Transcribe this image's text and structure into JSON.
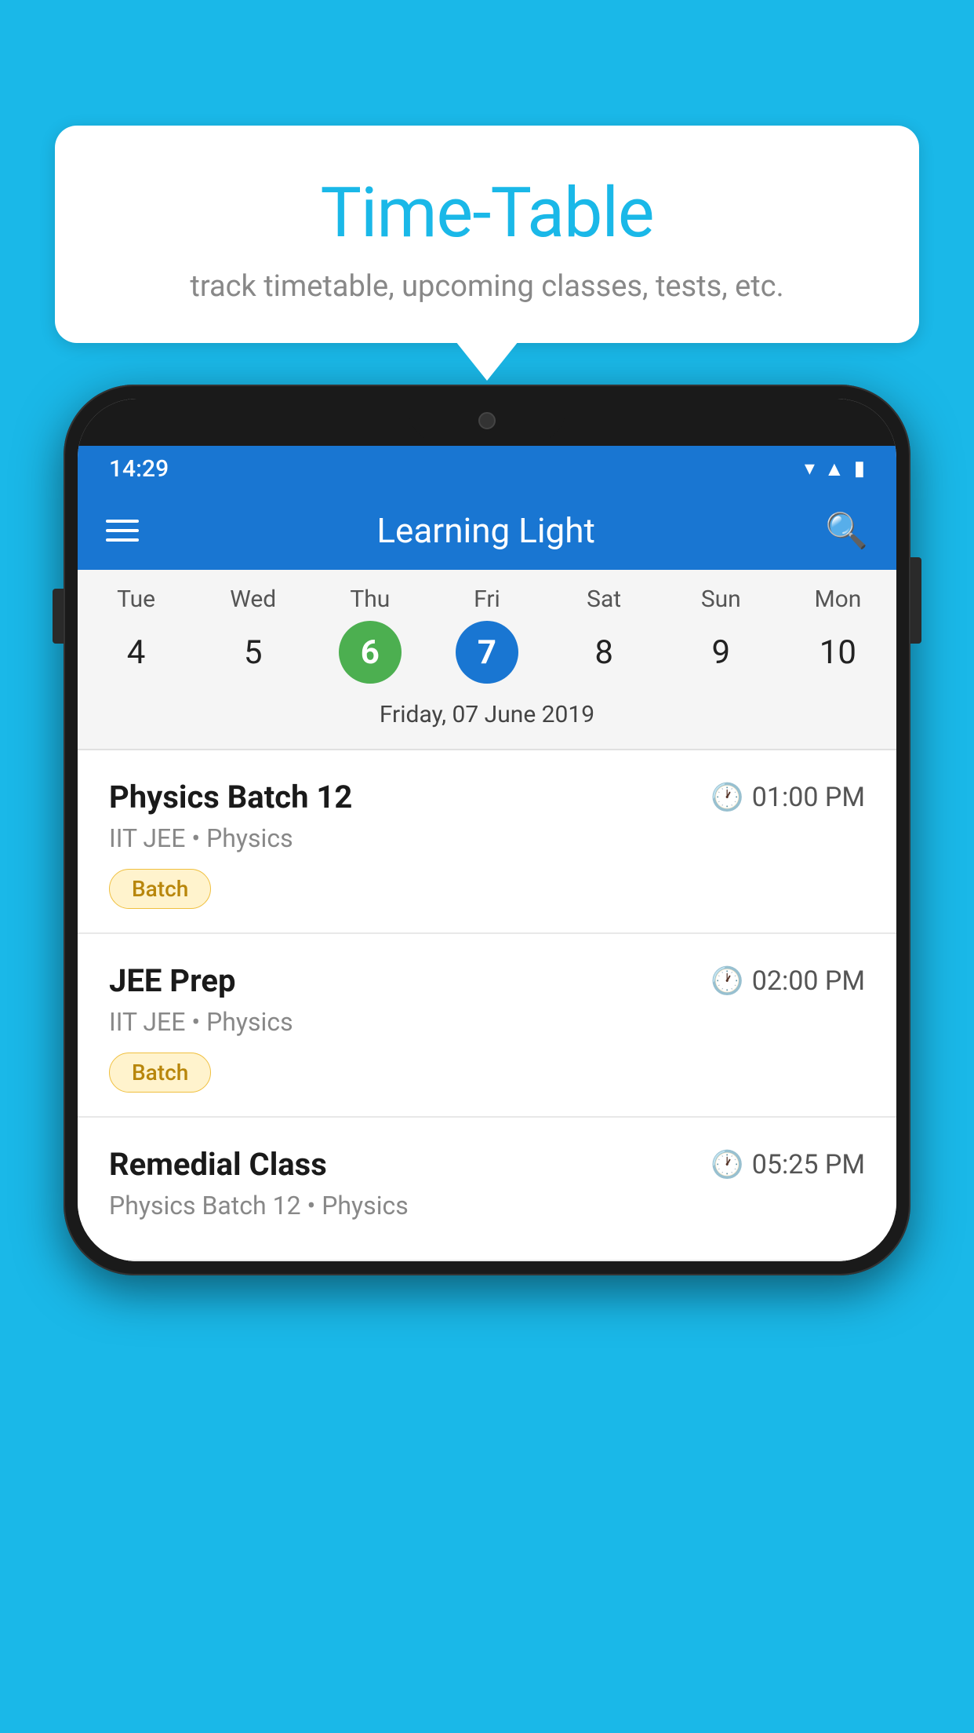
{
  "background": {
    "color": "#1ab8e8"
  },
  "speech_bubble": {
    "title": "Time-Table",
    "subtitle": "track timetable, upcoming classes, tests, etc."
  },
  "phone": {
    "status_bar": {
      "time": "14:29"
    },
    "app_bar": {
      "title": "Learning Light"
    },
    "calendar": {
      "days": [
        "Tue",
        "Wed",
        "Thu",
        "Fri",
        "Sat",
        "Sun",
        "Mon"
      ],
      "dates": [
        "4",
        "5",
        "6",
        "7",
        "8",
        "9",
        "10"
      ],
      "today_index": 2,
      "selected_index": 3,
      "selected_label": "Friday, 07 June 2019"
    },
    "schedule": [
      {
        "title": "Physics Batch 12",
        "time": "01:00 PM",
        "subtitle": "IIT JEE • Physics",
        "badge": "Batch"
      },
      {
        "title": "JEE Prep",
        "time": "02:00 PM",
        "subtitle": "IIT JEE • Physics",
        "badge": "Batch"
      },
      {
        "title": "Remedial Class",
        "time": "05:25 PM",
        "subtitle": "Physics Batch 12 • Physics",
        "badge": null
      }
    ]
  }
}
